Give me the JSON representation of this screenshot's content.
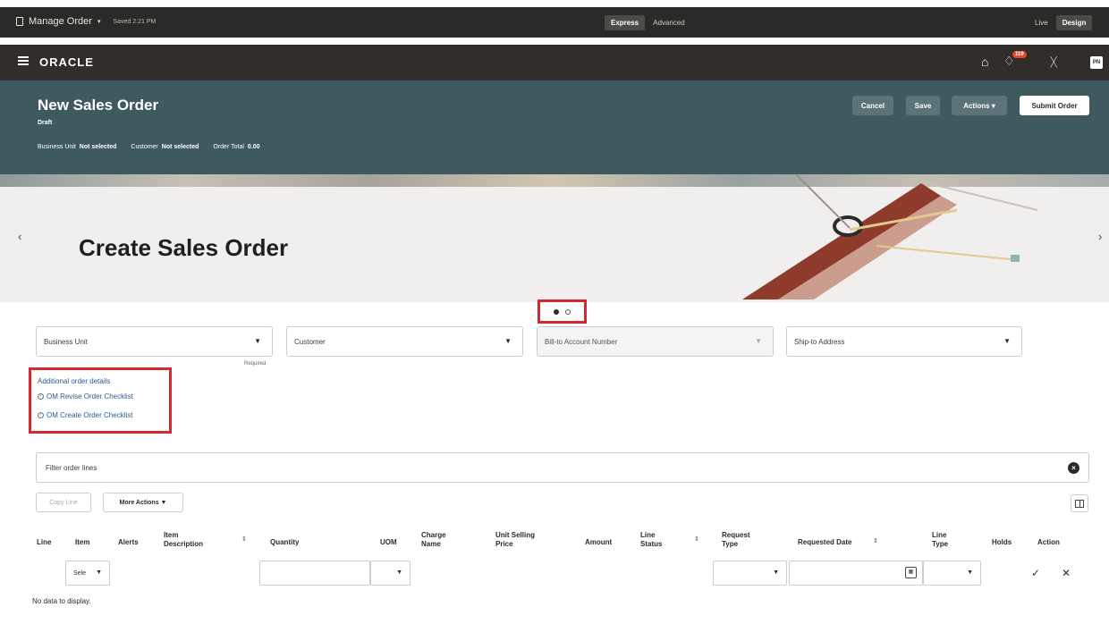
{
  "topbar": {
    "page_name": "Manage Order",
    "saved": "Saved 2:21 PM",
    "mode_express": "Express",
    "mode_advanced": "Advanced",
    "view_live": "Live",
    "view_design": "Design"
  },
  "header": {
    "logo": "ORACLE",
    "notification_count": "119",
    "avatar_initials": "PN"
  },
  "order": {
    "title": "New Sales Order",
    "status": "Draft",
    "business_unit_label": "Business Unit",
    "business_unit_value": "Not selected",
    "customer_label": "Customer",
    "customer_value": "Not selected",
    "order_total_label": "Order Total",
    "order_total_value": "0.00",
    "cancel": "Cancel",
    "save": "Save",
    "actions": "Actions",
    "submit": "Submit Order"
  },
  "banner": {
    "title": "Create Sales Order",
    "slide_count": 2,
    "active_slide": 1
  },
  "fields": {
    "business_unit": "Business Unit",
    "business_unit_hint": "Required",
    "customer": "Customer",
    "bill_to": "Bill-to Account Number",
    "ship_to": "Ship-to Address"
  },
  "details": {
    "title": "Additional order details",
    "revise_checklist": "OM Revise Order Checklist",
    "create_checklist": "OM Create Order Checklist"
  },
  "lines": {
    "filter_placeholder": "Filter order lines",
    "copy_line": "Copy Line",
    "more_actions": "More Actions",
    "columns": {
      "line": "Line",
      "item": "Item",
      "alerts": "Alerts",
      "item_description": "Item Description",
      "quantity": "Quantity",
      "uom": "UOM",
      "charge_name": "Charge Name",
      "unit_selling_price": "Unit Selling Price",
      "amount": "Amount",
      "line_status": "Line Status",
      "request_type": "Request Type",
      "requested_date": "Requested Date",
      "line_type": "Line Type",
      "holds": "Holds",
      "action": "Action"
    },
    "row_item_value": "Sele",
    "empty_message": "No data to display."
  }
}
